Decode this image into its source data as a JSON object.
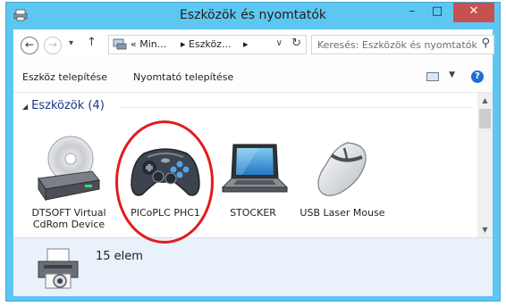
{
  "window": {
    "title": "Eszközök és nyomtatók",
    "min_label": "–",
    "max_label": "□",
    "close_label": "✕"
  },
  "nav": {
    "back_icon": "←",
    "forward_icon": "→",
    "recent_icon": "▾",
    "up_icon": "↑",
    "breadcrumb": [
      "« Min...",
      "▸ Eszköz...",
      "▸"
    ],
    "address_dropdown": "∨",
    "refresh_icon": "↻"
  },
  "search": {
    "placeholder": "Keresés: Eszközök és nyomtatók",
    "icon": "⚲"
  },
  "toolbar": {
    "add_device": "Eszköz telepítése",
    "add_printer": "Nyomtató telepítése",
    "view_dropdown": "▼",
    "help": "?"
  },
  "group": {
    "header": "Eszközök (4)",
    "collapse_icon": "◢"
  },
  "devices": [
    {
      "label": "DTSOFT Virtual CdRom Device",
      "icon": "cd-drive-icon"
    },
    {
      "label": "PICoPLC PHC1",
      "icon": "gamepad-icon"
    },
    {
      "label": "STOCKER",
      "icon": "laptop-icon"
    },
    {
      "label": "USB Laser Mouse",
      "icon": "mouse-icon"
    }
  ],
  "scroll": {
    "up": "▲",
    "down": "▼"
  },
  "details": {
    "count": "15 elem"
  },
  "colors": {
    "highlight_circle": "#e31b1b",
    "close": "#c75050",
    "group_header": "#1e3287"
  }
}
